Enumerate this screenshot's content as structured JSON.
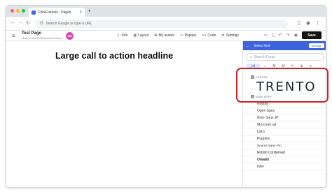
{
  "browser": {
    "tab_title": "ClickFunnels - Pages",
    "new_tab_label": "+",
    "tab_close": "×",
    "omnibox_placeholder": "Search Google or type a URL",
    "nav": {
      "back": "←",
      "forward": "→",
      "reload": "↻"
    }
  },
  "header": {
    "menu_icon": "≡",
    "page_title": "Test Page",
    "page_subtitle": "Maker's Aid's Clickfunnels Demo",
    "avatar_initials": "CM",
    "nav_items": [
      {
        "icon": "ⓘ",
        "label": "Info"
      },
      {
        "icon": "▦",
        "label": "Layout"
      },
      {
        "icon": "⊞",
        "label": "My assets"
      },
      {
        "icon": "▭",
        "label": "Popups"
      },
      {
        "icon": "<>",
        "label": "Code"
      },
      {
        "icon": "⚙",
        "label": "Settings"
      }
    ],
    "save_label": "Save"
  },
  "canvas": {
    "headline": "Large call to action headline"
  },
  "font_panel": {
    "title": "Select font",
    "back_icon": "←",
    "manage_label": "Manage",
    "search_placeholder": "Search Fonts",
    "filter_all": "All",
    "filter_chips": [
      "○",
      "M",
      "M",
      "✎",
      "⊕",
      "≡"
    ],
    "custom_label": "CUSTOM",
    "custom_preview": "TRENTO",
    "sans_serif_label": "SANS-SERIF",
    "fonts": [
      "Roboto",
      "Open Sans",
      "Noto Sans JP",
      "Montserrat",
      "Lato",
      "Poppins",
      "Source Sans Pro",
      "Roboto Condensed",
      "Oswald",
      "Inter"
    ]
  },
  "colors": {
    "accent": "#3d63dd",
    "annotation": "#d11f2a",
    "save_button": "#111111"
  }
}
